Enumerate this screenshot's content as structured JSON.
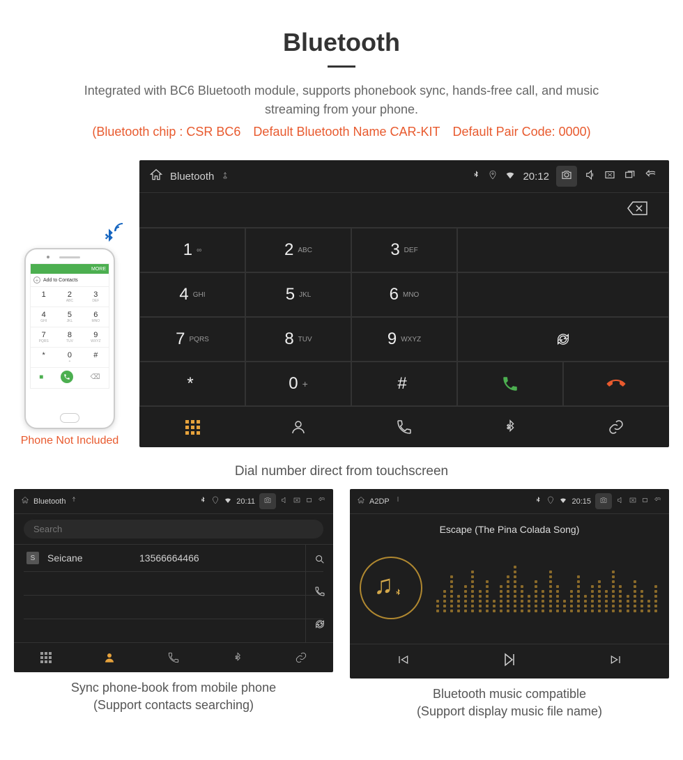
{
  "header": {
    "title": "Bluetooth",
    "desc": "Integrated with BC6 Bluetooth module, supports phonebook sync, hands-free call, and music streaming from your phone.",
    "specs": "(Bluetooth chip : CSR BC6 Default Bluetooth Name CAR-KIT Default Pair Code: 0000)"
  },
  "phone": {
    "topbar_more": "MORE",
    "add_contacts": "Add to Contacts",
    "not_included": "Phone Not Included",
    "keys": [
      {
        "n": "1",
        "s": ""
      },
      {
        "n": "2",
        "s": "ABC"
      },
      {
        "n": "3",
        "s": "DEF"
      },
      {
        "n": "4",
        "s": "GHI"
      },
      {
        "n": "5",
        "s": "JKL"
      },
      {
        "n": "6",
        "s": "MNO"
      },
      {
        "n": "7",
        "s": "PQRS"
      },
      {
        "n": "8",
        "s": "TUV"
      },
      {
        "n": "9",
        "s": "WXYZ"
      },
      {
        "n": "*",
        "s": ""
      },
      {
        "n": "0",
        "s": "+"
      },
      {
        "n": "#",
        "s": ""
      }
    ]
  },
  "hu_main": {
    "title": "Bluetooth",
    "time": "20:12",
    "keys": [
      {
        "n": "1",
        "s": "∞"
      },
      {
        "n": "2",
        "s": "ABC"
      },
      {
        "n": "3",
        "s": "DEF"
      },
      {
        "n": "4",
        "s": "GHI"
      },
      {
        "n": "5",
        "s": "JKL"
      },
      {
        "n": "6",
        "s": "MNO"
      },
      {
        "n": "7",
        "s": "PQRS"
      },
      {
        "n": "8",
        "s": "TUV"
      },
      {
        "n": "9",
        "s": "WXYZ"
      },
      {
        "n": "*",
        "s": ""
      },
      {
        "n": "0",
        "s": "+",
        "sup": true
      },
      {
        "n": "#",
        "s": ""
      }
    ],
    "caption": "Dial number direct from touchscreen"
  },
  "hu_contacts": {
    "title": "Bluetooth",
    "time": "20:11",
    "search_placeholder": "Search",
    "contact_name": "Seicane",
    "contact_number": "13566664466",
    "caption_line1": "Sync phone-book from mobile phone",
    "caption_line2": "(Support contacts searching)"
  },
  "hu_music": {
    "title": "A2DP",
    "time": "20:15",
    "track": "Escape (The Pina Colada Song)",
    "caption_line1": "Bluetooth music compatible",
    "caption_line2": "(Support display music file name)",
    "eq_heights": [
      3,
      5,
      8,
      4,
      6,
      9,
      5,
      7,
      3,
      6,
      8,
      10,
      6,
      4,
      7,
      5,
      9,
      6,
      3,
      5,
      8,
      4,
      6,
      7,
      5,
      9,
      6,
      4,
      7,
      5,
      3,
      6
    ]
  }
}
